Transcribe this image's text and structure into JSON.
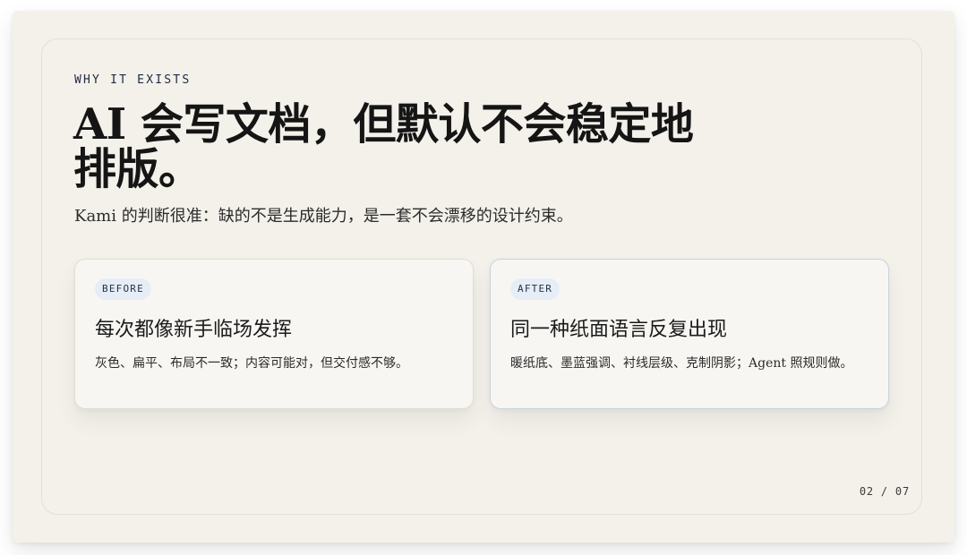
{
  "slide": {
    "eyebrow": "WHY IT EXISTS",
    "headline": "AI 会写文档，但默认不会稳定地排版。",
    "subtitle": "Kami 的判断很准：缺的不是生成能力，是一套不会漂移的设计约束。",
    "cards": [
      {
        "badge": "BEFORE",
        "title": "每次都像新手临场发挥",
        "desc": "灰色、扁平、布局不一致；内容可能对，但交付感不够。"
      },
      {
        "badge": "AFTER",
        "title": "同一种纸面语言反复出现",
        "desc": "暖纸底、墨蓝强调、衬线层级、克制阴影；Agent 照规则做。"
      }
    ],
    "pager": "02 / 07"
  },
  "colors": {
    "paper": "#f3f1ea",
    "ink": "#151515",
    "accent": "#1f2a44",
    "badge_bg": "#e7edf6"
  }
}
